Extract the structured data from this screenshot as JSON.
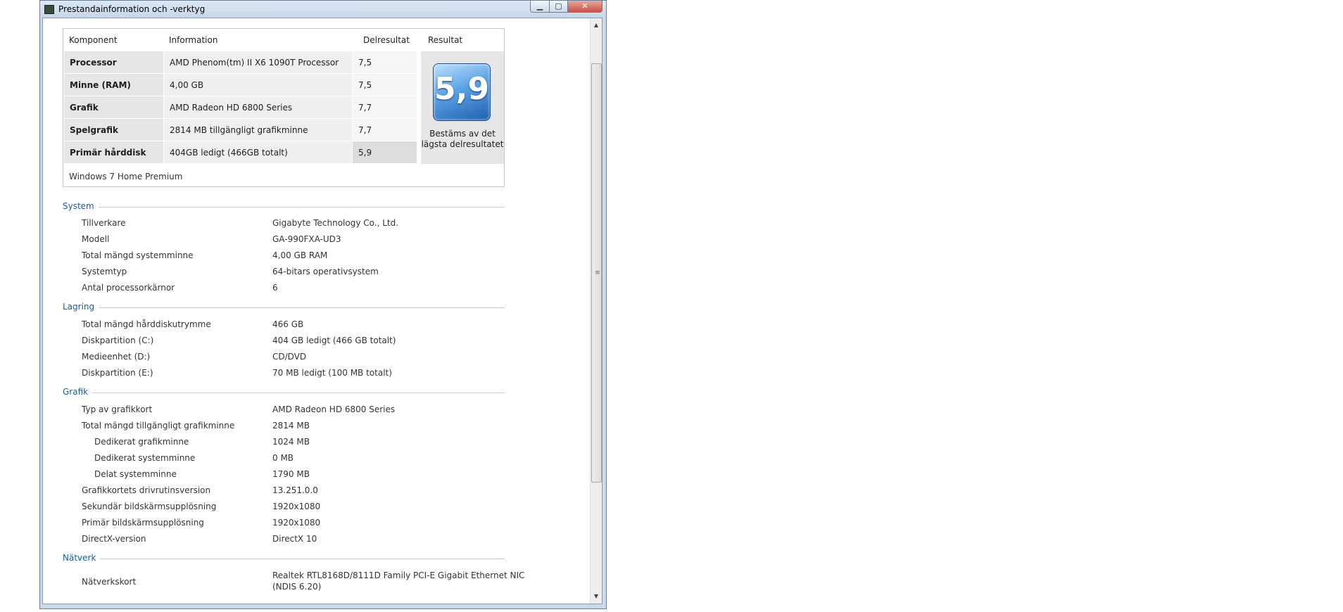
{
  "window": {
    "title": "Prestandainformation och -verktyg"
  },
  "scoreTable": {
    "headers": [
      "Komponent",
      "Information",
      "Delresultat",
      "Resultat"
    ],
    "rows": [
      {
        "component": "Processor",
        "info": "AMD Phenom(tm) II X6 1090T Processor",
        "sub": "7,5"
      },
      {
        "component": "Minne (RAM)",
        "info": "4,00 GB",
        "sub": "7,5"
      },
      {
        "component": "Grafik",
        "info": "AMD Radeon HD 6800 Series",
        "sub": "7,7"
      },
      {
        "component": "Spelgrafik",
        "info": "2814 MB tillgängligt grafikminne",
        "sub": "7,7"
      },
      {
        "component": "Primär hårddisk",
        "info": "404GB ledigt (466GB totalt)",
        "sub": "5,9"
      }
    ],
    "baseScore": "5,9",
    "baseScoreCaption": "Bestäms av det lägsta delresultatet",
    "os": "Windows 7 Home Premium"
  },
  "sections": [
    {
      "title": "System",
      "items": [
        {
          "key": "Tillverkare",
          "value": "Gigabyte Technology Co., Ltd."
        },
        {
          "key": "Modell",
          "value": "GA-990FXA-UD3"
        },
        {
          "key": "Total mängd systemminne",
          "value": "4,00 GB RAM"
        },
        {
          "key": "Systemtyp",
          "value": "64-bitars operativsystem"
        },
        {
          "key": "Antal processorkärnor",
          "value": "6"
        }
      ]
    },
    {
      "title": "Lagring",
      "items": [
        {
          "key": "Total mängd hårddiskutrymme",
          "value": "466 GB"
        },
        {
          "key": "Diskpartition (C:)",
          "value": "404 GB ledigt (466 GB totalt)"
        },
        {
          "key": "Medieenhet (D:)",
          "value": "CD/DVD"
        },
        {
          "key": "Diskpartition (E:)",
          "value": "70 MB ledigt (100 MB totalt)"
        }
      ]
    },
    {
      "title": "Grafik",
      "items": [
        {
          "key": "Typ av grafikkort",
          "value": "AMD Radeon HD 6800 Series"
        },
        {
          "key": "Total mängd tillgängligt grafikminne",
          "value": "2814 MB"
        },
        {
          "key": "Dedikerat grafikminne",
          "value": "1024 MB"
        },
        {
          "key": "Dedikerat systemminne",
          "value": "0 MB"
        },
        {
          "key": "Delat systemminne",
          "value": "1790 MB"
        },
        {
          "key": "Grafikkortets drivrutinsversion",
          "value": "13.251.0.0"
        },
        {
          "key": "Sekundär bildskärmsupplösning",
          "value": "1920x1080"
        },
        {
          "key": "Primär bildskärmsupplösning",
          "value": "1920x1080"
        },
        {
          "key": "DirectX-version",
          "value": "DirectX 10"
        }
      ]
    },
    {
      "title": "Nätverk",
      "items": [
        {
          "key": "Nätverkskort",
          "value": "Realtek RTL8168D/8111D Family PCI-E Gigabit Ethernet NIC",
          "value2": "(NDIS 6.20)"
        }
      ]
    }
  ],
  "icons": {
    "app": "performance-app-icon",
    "minimize": "minimize-icon",
    "maximize": "maximize-icon",
    "close": "close-icon"
  }
}
